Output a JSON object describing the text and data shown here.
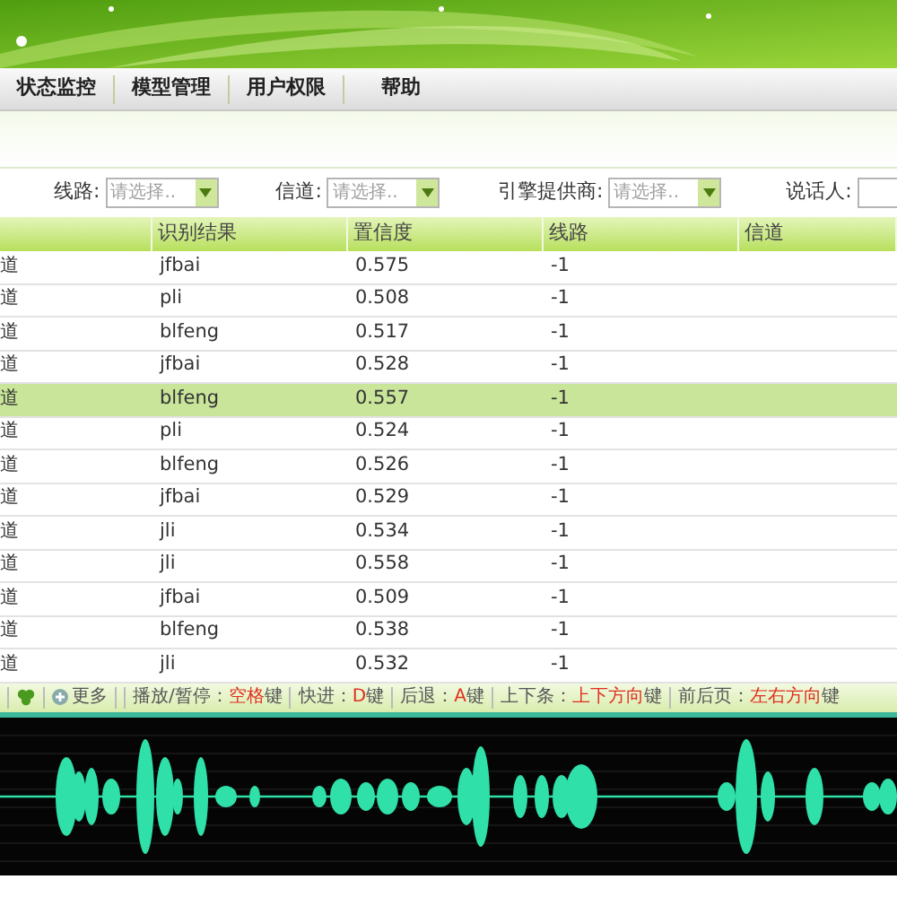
{
  "nav": [
    {
      "label": "状态监控"
    },
    {
      "label": "模型管理"
    },
    {
      "label": "用户权限"
    },
    {
      "label": "帮助"
    }
  ],
  "filters": [
    {
      "kind": "select",
      "label": "线路:",
      "placeholder": "请选择.."
    },
    {
      "kind": "select",
      "label": "信道:",
      "placeholder": "请选择.."
    },
    {
      "kind": "select",
      "label": "引擎提供商:",
      "placeholder": "请选择.."
    },
    {
      "kind": "input",
      "label": "说话人:"
    }
  ],
  "table": {
    "columns": [
      "",
      "识别结果",
      "置信度",
      "线路",
      "信道"
    ],
    "rows": [
      {
        "cells": [
          "道",
          "jfbai",
          "0.575",
          "-1",
          ""
        ],
        "selected": false
      },
      {
        "cells": [
          "道",
          "pli",
          "0.508",
          "-1",
          ""
        ],
        "selected": false
      },
      {
        "cells": [
          "道",
          "blfeng",
          "0.517",
          "-1",
          ""
        ],
        "selected": false
      },
      {
        "cells": [
          "道",
          "jfbai",
          "0.528",
          "-1",
          ""
        ],
        "selected": false
      },
      {
        "cells": [
          "道",
          "blfeng",
          "0.557",
          "-1",
          ""
        ],
        "selected": true
      },
      {
        "cells": [
          "道",
          "pli",
          "0.524",
          "-1",
          ""
        ],
        "selected": false
      },
      {
        "cells": [
          "道",
          "blfeng",
          "0.526",
          "-1",
          ""
        ],
        "selected": false
      },
      {
        "cells": [
          "道",
          "jfbai",
          "0.529",
          "-1",
          ""
        ],
        "selected": false
      },
      {
        "cells": [
          "道",
          "jli",
          "0.534",
          "-1",
          ""
        ],
        "selected": false
      },
      {
        "cells": [
          "道",
          "jli",
          "0.558",
          "-1",
          ""
        ],
        "selected": false
      },
      {
        "cells": [
          "道",
          "jfbai",
          "0.509",
          "-1",
          ""
        ],
        "selected": false
      },
      {
        "cells": [
          "道",
          "blfeng",
          "0.538",
          "-1",
          ""
        ],
        "selected": false
      },
      {
        "cells": [
          "道",
          "jli",
          "0.532",
          "-1",
          ""
        ],
        "selected": false
      }
    ]
  },
  "toolbar": {
    "more": "更多",
    "hints": [
      {
        "label": "播放/暂停：",
        "key": "空格",
        "suffix": "键"
      },
      {
        "label": "快进：",
        "key": "D",
        "suffix": "键"
      },
      {
        "label": "后退：",
        "key": "A",
        "suffix": "键"
      },
      {
        "label": "上下条：",
        "key": "上下方向",
        "suffix": "键"
      },
      {
        "label": "前后页：",
        "key": "左右方向",
        "suffix": "键"
      }
    ]
  }
}
